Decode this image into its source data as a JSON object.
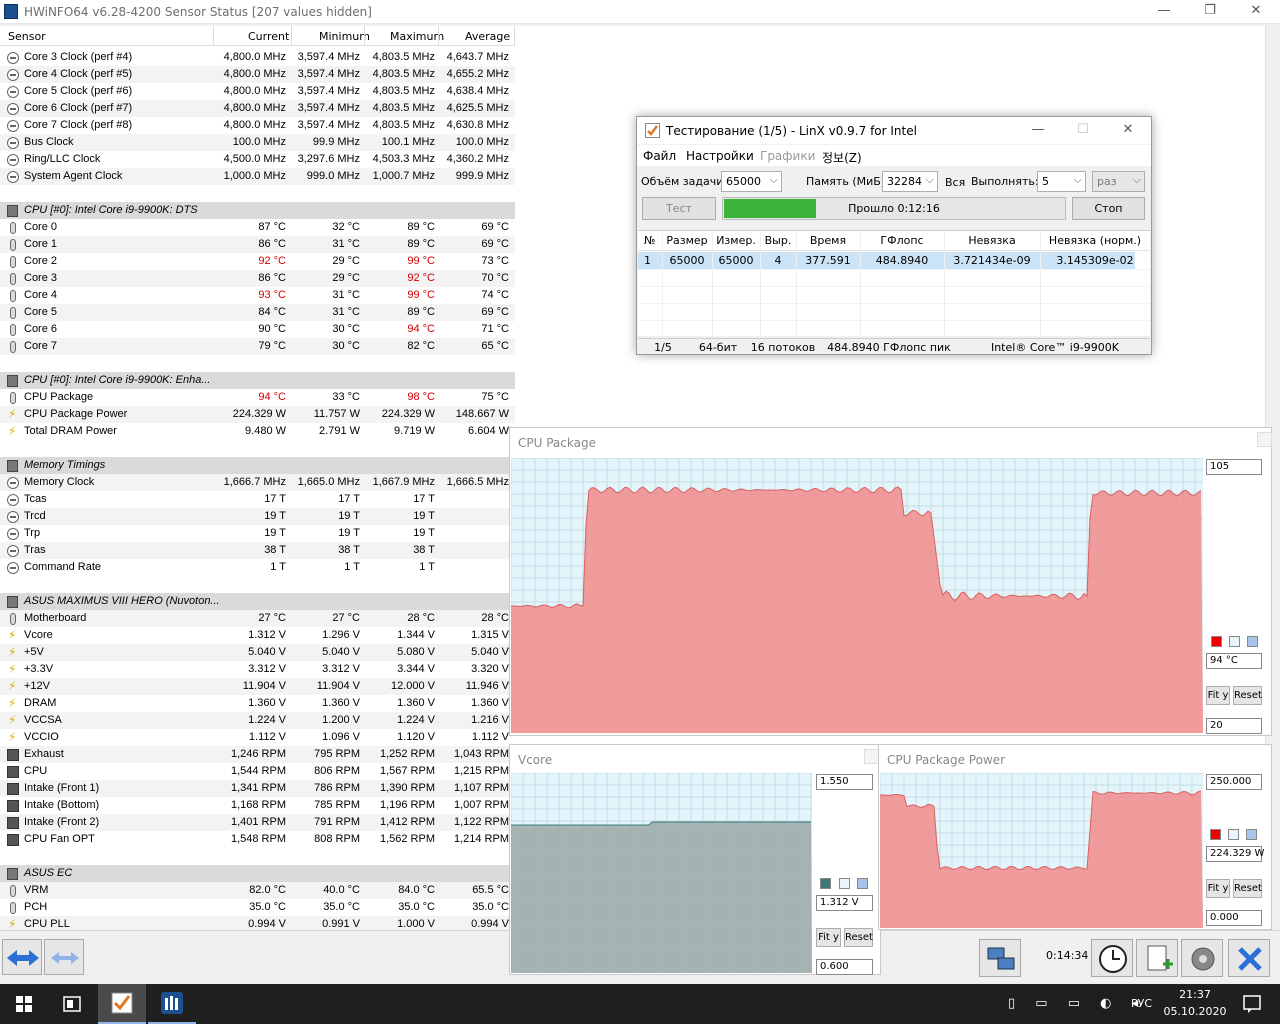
{
  "window": {
    "title": "HWiNFO64 v6.28-4200 Sensor Status [207 values hidden]"
  },
  "columns": [
    "Sensor",
    "Current",
    "Minimum",
    "Maximum",
    "Average"
  ],
  "rows": [
    {
      "t": "s",
      "icon": "clock",
      "name": "Core 3 Clock (perf #4)",
      "v": [
        "4,800.0 MHz",
        "3,597.4 MHz",
        "4,803.5 MHz",
        "4,643.7 MHz"
      ]
    },
    {
      "t": "s",
      "icon": "clock",
      "name": "Core 4 Clock (perf #5)",
      "v": [
        "4,800.0 MHz",
        "3,597.4 MHz",
        "4,803.5 MHz",
        "4,655.2 MHz"
      ]
    },
    {
      "t": "s",
      "icon": "clock",
      "name": "Core 5 Clock (perf #6)",
      "v": [
        "4,800.0 MHz",
        "3,597.4 MHz",
        "4,803.5 MHz",
        "4,638.4 MHz"
      ]
    },
    {
      "t": "s",
      "icon": "clock",
      "name": "Core 6 Clock (perf #7)",
      "v": [
        "4,800.0 MHz",
        "3,597.4 MHz",
        "4,803.5 MHz",
        "4,625.5 MHz"
      ]
    },
    {
      "t": "s",
      "icon": "clock",
      "name": "Core 7 Clock (perf #8)",
      "v": [
        "4,800.0 MHz",
        "3,597.4 MHz",
        "4,803.5 MHz",
        "4,630.8 MHz"
      ]
    },
    {
      "t": "s",
      "icon": "clock",
      "name": "Bus Clock",
      "v": [
        "100.0 MHz",
        "99.9 MHz",
        "100.1 MHz",
        "100.0 MHz"
      ]
    },
    {
      "t": "s",
      "icon": "clock",
      "name": "Ring/LLC Clock",
      "v": [
        "4,500.0 MHz",
        "3,297.6 MHz",
        "4,503.3 MHz",
        "4,360.2 MHz"
      ]
    },
    {
      "t": "s",
      "icon": "clock",
      "name": "System Agent Clock",
      "v": [
        "1,000.0 MHz",
        "999.0 MHz",
        "1,000.7 MHz",
        "999.9 MHz"
      ]
    },
    {
      "t": "e"
    },
    {
      "t": "g",
      "icon": "chip",
      "name": "CPU [#0]: Intel Core i9-9900K: DTS"
    },
    {
      "t": "s",
      "icon": "therm",
      "name": "Core 0",
      "v": [
        "87 °C",
        "32 °C",
        "89 °C",
        "69 °C"
      ]
    },
    {
      "t": "s",
      "icon": "therm",
      "name": "Core 1",
      "v": [
        "86 °C",
        "31 °C",
        "89 °C",
        "69 °C"
      ]
    },
    {
      "t": "s",
      "icon": "therm",
      "name": "Core 2",
      "v": [
        "92 °C",
        "29 °C",
        "99 °C",
        "73 °C"
      ],
      "red": [
        0,
        2
      ]
    },
    {
      "t": "s",
      "icon": "therm",
      "name": "Core 3",
      "v": [
        "86 °C",
        "29 °C",
        "92 °C",
        "70 °C"
      ],
      "red": [
        2
      ]
    },
    {
      "t": "s",
      "icon": "therm",
      "name": "Core 4",
      "v": [
        "93 °C",
        "31 °C",
        "99 °C",
        "74 °C"
      ],
      "red": [
        0,
        2
      ]
    },
    {
      "t": "s",
      "icon": "therm",
      "name": "Core 5",
      "v": [
        "84 °C",
        "31 °C",
        "89 °C",
        "69 °C"
      ]
    },
    {
      "t": "s",
      "icon": "therm",
      "name": "Core 6",
      "v": [
        "90 °C",
        "30 °C",
        "94 °C",
        "71 °C"
      ],
      "red": [
        2
      ]
    },
    {
      "t": "s",
      "icon": "therm",
      "name": "Core 7",
      "v": [
        "79 °C",
        "30 °C",
        "82 °C",
        "65 °C"
      ]
    },
    {
      "t": "e"
    },
    {
      "t": "g",
      "icon": "chip",
      "name": "CPU [#0]: Intel Core i9-9900K: Enha..."
    },
    {
      "t": "s",
      "icon": "therm",
      "name": "CPU Package",
      "v": [
        "94 °C",
        "33 °C",
        "98 °C",
        "75 °C"
      ],
      "red": [
        0,
        2
      ]
    },
    {
      "t": "s",
      "icon": "bolt",
      "name": "CPU Package Power",
      "v": [
        "224.329 W",
        "11.757 W",
        "224.329 W",
        "148.667 W"
      ]
    },
    {
      "t": "s",
      "icon": "bolt",
      "name": "Total DRAM Power",
      "v": [
        "9.480 W",
        "2.791 W",
        "9.719 W",
        "6.604 W"
      ]
    },
    {
      "t": "e"
    },
    {
      "t": "g",
      "icon": "chip",
      "name": "Memory Timings"
    },
    {
      "t": "s",
      "icon": "clock",
      "name": "Memory Clock",
      "v": [
        "1,666.7 MHz",
        "1,665.0 MHz",
        "1,667.9 MHz",
        "1,666.5 MHz"
      ]
    },
    {
      "t": "s",
      "icon": "clock",
      "name": "Tcas",
      "v": [
        "17 T",
        "17 T",
        "17 T",
        ""
      ]
    },
    {
      "t": "s",
      "icon": "clock",
      "name": "Trcd",
      "v": [
        "19 T",
        "19 T",
        "19 T",
        ""
      ]
    },
    {
      "t": "s",
      "icon": "clock",
      "name": "Trp",
      "v": [
        "19 T",
        "19 T",
        "19 T",
        ""
      ]
    },
    {
      "t": "s",
      "icon": "clock",
      "name": "Tras",
      "v": [
        "38 T",
        "38 T",
        "38 T",
        ""
      ]
    },
    {
      "t": "s",
      "icon": "clock",
      "name": "Command Rate",
      "v": [
        "1 T",
        "1 T",
        "1 T",
        ""
      ]
    },
    {
      "t": "e"
    },
    {
      "t": "g",
      "icon": "chip",
      "name": "ASUS MAXIMUS VIII HERO (Nuvoton..."
    },
    {
      "t": "s",
      "icon": "therm",
      "name": "Motherboard",
      "v": [
        "27 °C",
        "27 °C",
        "28 °C",
        "28 °C"
      ]
    },
    {
      "t": "s",
      "icon": "bolt",
      "name": "Vcore",
      "v": [
        "1.312 V",
        "1.296 V",
        "1.344 V",
        "1.315 V"
      ]
    },
    {
      "t": "s",
      "icon": "bolt",
      "name": "+5V",
      "v": [
        "5.040 V",
        "5.040 V",
        "5.080 V",
        "5.040 V"
      ]
    },
    {
      "t": "s",
      "icon": "bolt",
      "name": "+3.3V",
      "v": [
        "3.312 V",
        "3.312 V",
        "3.344 V",
        "3.320 V"
      ]
    },
    {
      "t": "s",
      "icon": "bolt",
      "name": "+12V",
      "v": [
        "11.904 V",
        "11.904 V",
        "12.000 V",
        "11.946 V"
      ]
    },
    {
      "t": "s",
      "icon": "bolt",
      "name": "DRAM",
      "v": [
        "1.360 V",
        "1.360 V",
        "1.360 V",
        "1.360 V"
      ]
    },
    {
      "t": "s",
      "icon": "bolt",
      "name": "VCCSA",
      "v": [
        "1.224 V",
        "1.200 V",
        "1.224 V",
        "1.216 V"
      ]
    },
    {
      "t": "s",
      "icon": "bolt",
      "name": "VCCIO",
      "v": [
        "1.112 V",
        "1.096 V",
        "1.120 V",
        "1.112 V"
      ]
    },
    {
      "t": "s",
      "icon": "fan",
      "name": "Exhaust",
      "v": [
        "1,246 RPM",
        "795 RPM",
        "1,252 RPM",
        "1,043 RPM"
      ]
    },
    {
      "t": "s",
      "icon": "fan",
      "name": "CPU",
      "v": [
        "1,544 RPM",
        "806 RPM",
        "1,567 RPM",
        "1,215 RPM"
      ]
    },
    {
      "t": "s",
      "icon": "fan",
      "name": "Intake (Front 1)",
      "v": [
        "1,341 RPM",
        "786 RPM",
        "1,390 RPM",
        "1,107 RPM"
      ]
    },
    {
      "t": "s",
      "icon": "fan",
      "name": "Intake (Bottom)",
      "v": [
        "1,168 RPM",
        "785 RPM",
        "1,196 RPM",
        "1,007 RPM"
      ]
    },
    {
      "t": "s",
      "icon": "fan",
      "name": "Intake (Front 2)",
      "v": [
        "1,401 RPM",
        "791 RPM",
        "1,412 RPM",
        "1,122 RPM"
      ]
    },
    {
      "t": "s",
      "icon": "fan",
      "name": "CPU Fan OPT",
      "v": [
        "1,548 RPM",
        "808 RPM",
        "1,562 RPM",
        "1,214 RPM"
      ]
    },
    {
      "t": "e"
    },
    {
      "t": "g",
      "icon": "chip",
      "name": "ASUS EC"
    },
    {
      "t": "s",
      "icon": "therm",
      "name": "VRM",
      "v": [
        "82.0 °C",
        "40.0 °C",
        "84.0 °C",
        "65.5 °C"
      ]
    },
    {
      "t": "s",
      "icon": "therm",
      "name": "PCH",
      "v": [
        "35.0 °C",
        "35.0 °C",
        "35.0 °C",
        "35.0 °C"
      ]
    },
    {
      "t": "s",
      "icon": "bolt",
      "name": "CPU PLL",
      "v": [
        "0.994 V",
        "0.991 V",
        "1.000 V",
        "0.994 V"
      ]
    }
  ],
  "bottombar": {
    "uptime": "0:14:34"
  },
  "linx": {
    "title": "Тестирование (1/5) - LinX v0.9.7 for Intel",
    "menu": [
      "Файл",
      "Настройки",
      "Графики",
      "정보(Z)"
    ],
    "task_label": "Объём задачи:",
    "task_value": "65000",
    "mem_label": "Память (МиБ):",
    "mem_value": "32284",
    "mem_all": "Вся",
    "run_label": "Выполнять:",
    "run_value": "5",
    "run_unit": "раз",
    "test_button": "Тест",
    "progress_text": "Прошло 0:12:16",
    "progress_fraction": 0.2,
    "stop_button": "Стоп",
    "table_headers": [
      "№",
      "Размер",
      "Измер.",
      "Выр.",
      "Время",
      "ГФлопс",
      "Невязка",
      "Невязка (норм.)"
    ],
    "table_rows": [
      [
        "1",
        "65000",
        "65000",
        "4",
        "377.591",
        "484.8940",
        "3.721434e-09",
        "3.145309e-02"
      ]
    ],
    "status": [
      "1/5",
      "64-бит",
      "16 потоков",
      "484.8940 ГФлопс пик",
      "Intel® Core™ i9-9900K"
    ]
  },
  "graphs": {
    "cpu_package": {
      "title": "CPU Package",
      "max": "105",
      "current": "94 °C",
      "min": "20",
      "fit": "Fit y",
      "reset": "Reset",
      "color": "#f28b8b"
    },
    "vcore": {
      "title": "Vcore",
      "max": "1.550",
      "current": "1.312 V",
      "min": "0.600",
      "fit": "Fit y",
      "reset": "Reset",
      "color": "#9aa8a4"
    },
    "package_power": {
      "title": "CPU Package Power",
      "max": "250.000",
      "current": "224.329 W",
      "min": "0.000",
      "fit": "Fit y",
      "reset": "Reset",
      "color": "#f28b8b"
    }
  },
  "taskbar": {
    "lang": "РУС",
    "time": "21:37",
    "date": "05.10.2020"
  }
}
